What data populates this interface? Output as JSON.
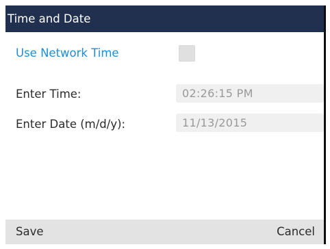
{
  "window": {
    "title": "Time and Date"
  },
  "form": {
    "use_network_time": {
      "label": "Use Network Time",
      "checked": false
    },
    "time": {
      "label": "Enter Time:",
      "value": "02:26:15 PM"
    },
    "date": {
      "label": "Enter Date (m/d/y):",
      "value": "11/13/2015"
    }
  },
  "softkeys": {
    "save_label": "Save",
    "cancel_label": "Cancel"
  },
  "colors": {
    "titlebar": "#20304e",
    "accent": "#1a8fd6",
    "softkey_bar": "#e3e3e3",
    "field_bg": "#f0f0f0"
  }
}
